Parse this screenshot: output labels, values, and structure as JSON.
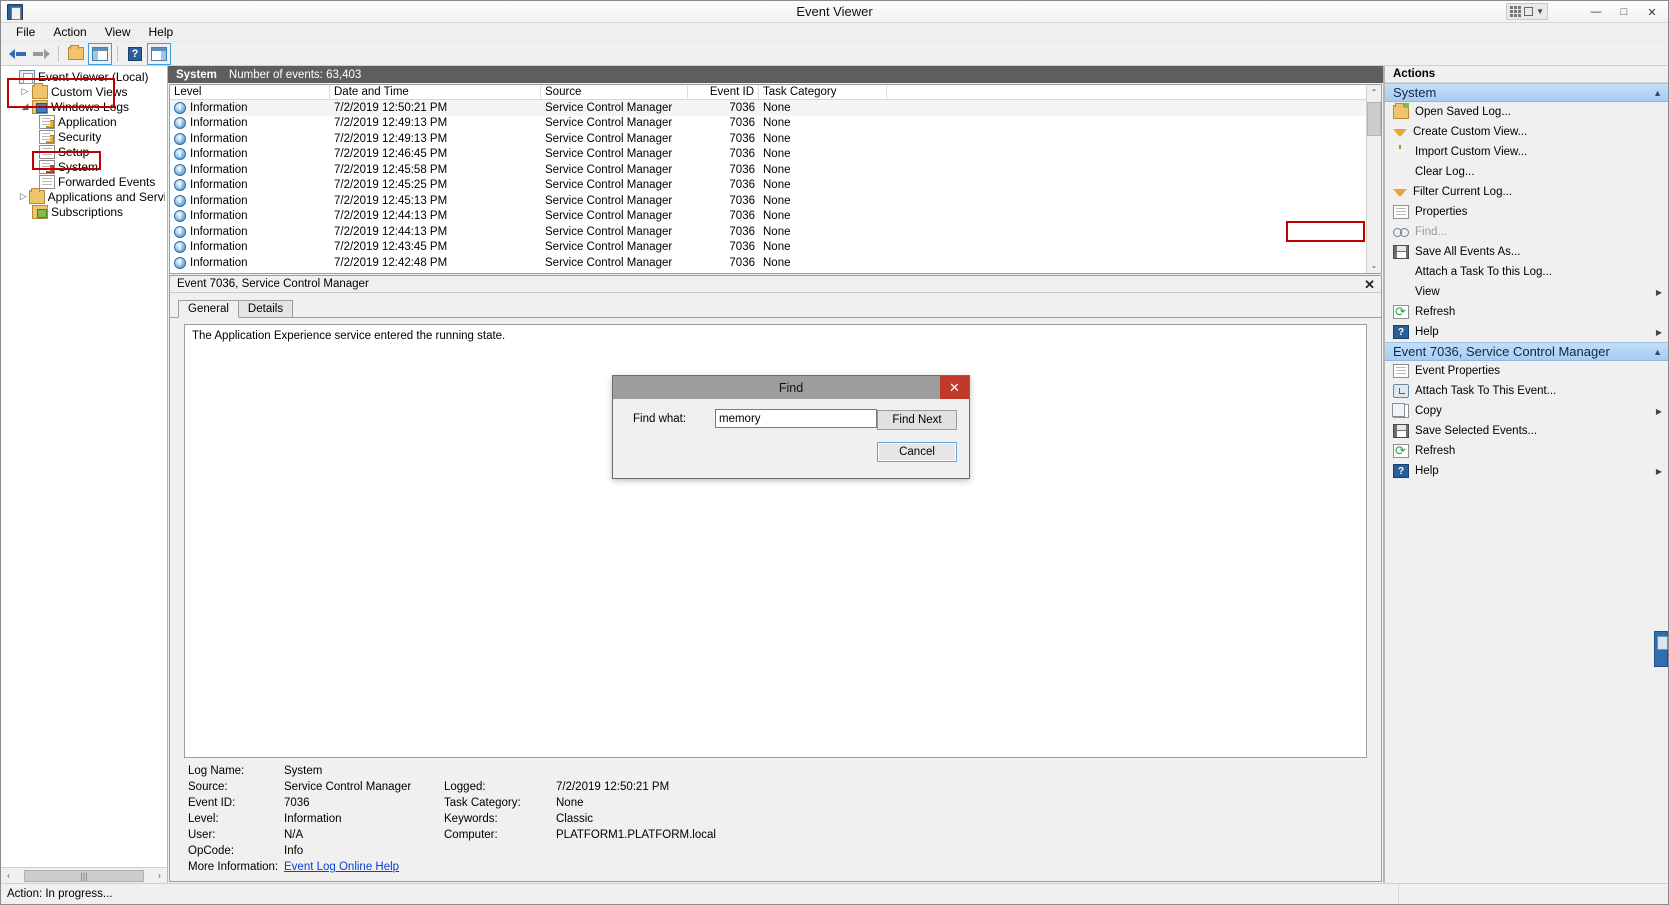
{
  "window": {
    "title": "Event Viewer",
    "minimize": "—",
    "maximize": "□",
    "close": "✕"
  },
  "menu": [
    "File",
    "Action",
    "View",
    "Help"
  ],
  "toolbar": {
    "back": "back-arrow",
    "forward": "forward-arrow",
    "open": "open-folder-icon",
    "show_pane": "show-console-tree-icon",
    "help": "?",
    "show_action_pane": "show-action-pane-icon"
  },
  "tree": {
    "root": "Event Viewer (Local)",
    "items": [
      {
        "label": "Custom Views",
        "level": 1,
        "expander": "▷",
        "icon": "folder-icon"
      },
      {
        "label": "Windows Logs",
        "level": 1,
        "expander": "◢",
        "icon": "folder-blue-icon"
      },
      {
        "label": "Application",
        "level": 2,
        "expander": "",
        "icon": "log-yellow-icon"
      },
      {
        "label": "Security",
        "level": 2,
        "expander": "",
        "icon": "log-yellow-icon"
      },
      {
        "label": "Setup",
        "level": 2,
        "expander": "",
        "icon": "log-icon"
      },
      {
        "label": "System",
        "level": 2,
        "expander": "",
        "icon": "log-red-icon"
      },
      {
        "label": "Forwarded Events",
        "level": 2,
        "expander": "",
        "icon": "log-icon"
      },
      {
        "label": "Applications and Services Lo",
        "level": 1,
        "expander": "▷",
        "icon": "folder-icon"
      },
      {
        "label": "Subscriptions",
        "level": 1,
        "expander": "",
        "icon": "subscriptions-icon"
      }
    ],
    "hscroll_left": "‹",
    "hscroll_right": "›",
    "hscroll_thumb": "|||"
  },
  "list": {
    "log_name": "System",
    "count_label": "Number of events: 63,403",
    "columns": [
      "Level",
      "Date and Time",
      "Source",
      "Event ID",
      "Task Category"
    ],
    "rows": [
      {
        "level": "Information",
        "datetime": "7/2/2019 12:50:21 PM",
        "source": "Service Control Manager",
        "event_id": "7036",
        "task": "None"
      },
      {
        "level": "Information",
        "datetime": "7/2/2019 12:49:13 PM",
        "source": "Service Control Manager",
        "event_id": "7036",
        "task": "None"
      },
      {
        "level": "Information",
        "datetime": "7/2/2019 12:49:13 PM",
        "source": "Service Control Manager",
        "event_id": "7036",
        "task": "None"
      },
      {
        "level": "Information",
        "datetime": "7/2/2019 12:46:45 PM",
        "source": "Service Control Manager",
        "event_id": "7036",
        "task": "None"
      },
      {
        "level": "Information",
        "datetime": "7/2/2019 12:45:58 PM",
        "source": "Service Control Manager",
        "event_id": "7036",
        "task": "None"
      },
      {
        "level": "Information",
        "datetime": "7/2/2019 12:45:25 PM",
        "source": "Service Control Manager",
        "event_id": "7036",
        "task": "None"
      },
      {
        "level": "Information",
        "datetime": "7/2/2019 12:45:13 PM",
        "source": "Service Control Manager",
        "event_id": "7036",
        "task": "None"
      },
      {
        "level": "Information",
        "datetime": "7/2/2019 12:44:13 PM",
        "source": "Service Control Manager",
        "event_id": "7036",
        "task": "None"
      },
      {
        "level": "Information",
        "datetime": "7/2/2019 12:44:13 PM",
        "source": "Service Control Manager",
        "event_id": "7036",
        "task": "None"
      },
      {
        "level": "Information",
        "datetime": "7/2/2019 12:43:45 PM",
        "source": "Service Control Manager",
        "event_id": "7036",
        "task": "None"
      },
      {
        "level": "Information",
        "datetime": "7/2/2019 12:42:48 PM",
        "source": "Service Control Manager",
        "event_id": "7036",
        "task": "None"
      }
    ]
  },
  "detail": {
    "header": "Event 7036, Service Control Manager",
    "close": "✕",
    "tabs": [
      "General",
      "Details"
    ],
    "message": "The Application Experience service entered the running state.",
    "fields": {
      "log_name_label": "Log Name:",
      "log_name_value": "System",
      "source_label": "Source:",
      "source_value": "Service Control Manager",
      "logged_label": "Logged:",
      "logged_value": "7/2/2019 12:50:21 PM",
      "event_id_label": "Event ID:",
      "event_id_value": "7036",
      "task_category_label": "Task Category:",
      "task_category_value": "None",
      "level_label": "Level:",
      "level_value": "Information",
      "keywords_label": "Keywords:",
      "keywords_value": "Classic",
      "user_label": "User:",
      "user_value": "N/A",
      "computer_label": "Computer:",
      "computer_value": "PLATFORM1.PLATFORM.local",
      "opcode_label": "OpCode:",
      "opcode_value": "Info",
      "more_info_label": "More Information:",
      "more_info_link": "Event Log Online Help"
    }
  },
  "actions": {
    "title": "Actions",
    "group1": {
      "title": "System",
      "caret": "▲"
    },
    "group1_items": [
      {
        "label": "Open Saved Log...",
        "icon": "open-saved-log-icon",
        "disabled": false,
        "submenu": ""
      },
      {
        "label": "Create Custom View...",
        "icon": "funnel-icon",
        "disabled": false,
        "submenu": ""
      },
      {
        "label": "Import Custom View...",
        "icon": "",
        "disabled": false,
        "submenu": ""
      },
      {
        "label": "Clear Log...",
        "icon": "",
        "disabled": false,
        "submenu": ""
      },
      {
        "label": "Filter Current Log...",
        "icon": "funnel-icon",
        "disabled": false,
        "submenu": ""
      },
      {
        "label": "Properties",
        "icon": "properties-icon",
        "disabled": false,
        "submenu": ""
      },
      {
        "label": "Find...",
        "icon": "find-binoculars-icon",
        "disabled": true,
        "submenu": ""
      },
      {
        "label": "Save All Events As...",
        "icon": "save-icon",
        "disabled": false,
        "submenu": ""
      },
      {
        "label": "Attach a Task To this Log...",
        "icon": "",
        "disabled": false,
        "submenu": ""
      },
      {
        "label": "View",
        "icon": "",
        "disabled": false,
        "submenu": "▶"
      },
      {
        "label": "Refresh",
        "icon": "refresh-icon",
        "disabled": false,
        "submenu": ""
      },
      {
        "label": "Help",
        "icon": "help-icon",
        "disabled": false,
        "submenu": "▶"
      }
    ],
    "group2": {
      "title": "Event 7036, Service Control Manager",
      "caret": "▲"
    },
    "group2_items": [
      {
        "label": "Event Properties",
        "icon": "event-properties-icon",
        "disabled": false,
        "submenu": ""
      },
      {
        "label": "Attach Task To This Event...",
        "icon": "attach-task-icon",
        "disabled": false,
        "submenu": ""
      },
      {
        "label": "Copy",
        "icon": "copy-icon",
        "disabled": false,
        "submenu": "▶"
      },
      {
        "label": "Save Selected Events...",
        "icon": "save-icon",
        "disabled": false,
        "submenu": ""
      },
      {
        "label": "Refresh",
        "icon": "refresh-icon",
        "disabled": false,
        "submenu": ""
      },
      {
        "label": "Help",
        "icon": "help-icon",
        "disabled": false,
        "submenu": "▶"
      }
    ]
  },
  "find_dialog": {
    "title": "Find",
    "close": "✕",
    "label": "Find what:",
    "value": "memory",
    "placeholder": "",
    "find_next": "Find Next",
    "cancel": "Cancel"
  },
  "statusbar": {
    "text": "Action: In progress..."
  },
  "colors": {
    "accent": "#2a6099",
    "annotation": "#c00000",
    "group_header": "#a8cdf2",
    "list_header_bar": "#5e5e5e",
    "dialog_titlebar": "#9d9d9d",
    "dialog_close": "#c0392b",
    "link": "#0b3fd4"
  }
}
